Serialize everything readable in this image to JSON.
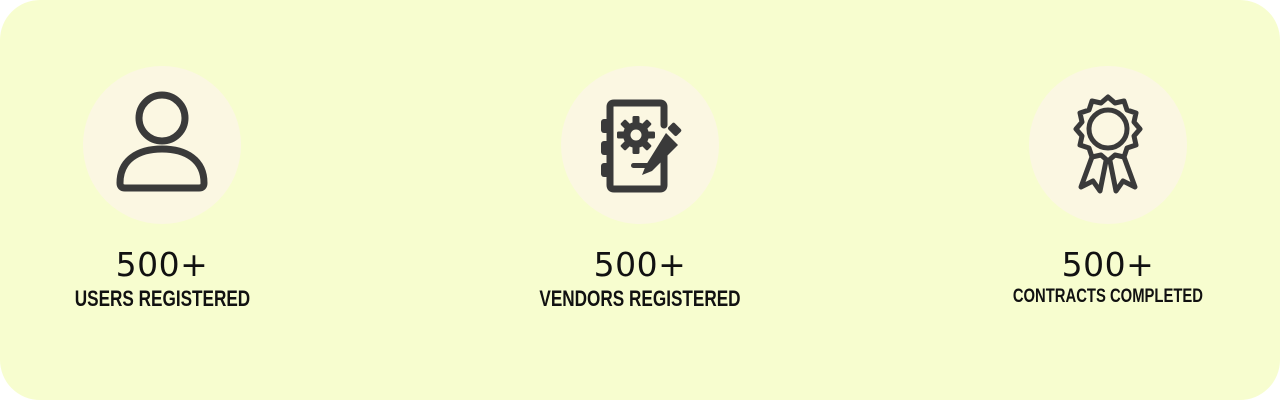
{
  "colors": {
    "panel_background": "#f7fdcf",
    "icon_circle": "#fbf7e2",
    "icon_stroke": "#3a3a3a",
    "text": "#111111"
  },
  "stats": [
    {
      "icon": "user-icon",
      "value": "500+",
      "label": "USERS REGISTERED"
    },
    {
      "icon": "notebook-gear-pencil-icon",
      "value": "500+",
      "label": "VENDORS REGISTERED"
    },
    {
      "icon": "award-ribbon-icon",
      "value": "500+",
      "label": "CONTRACTS COMPLETED"
    }
  ]
}
